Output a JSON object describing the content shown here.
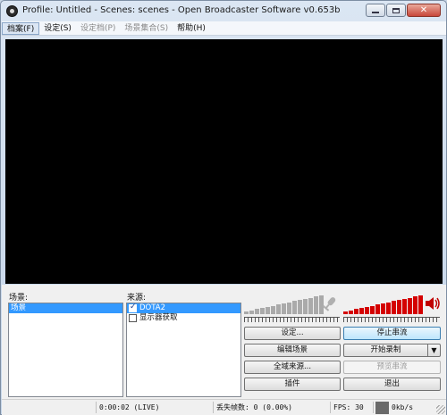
{
  "window": {
    "title": "Profile: Untitled - Scenes: scenes - Open Broadcaster Software v0.653b"
  },
  "menu": [
    {
      "label": "档案(F)",
      "state": "active"
    },
    {
      "label": "设定(S)",
      "state": "normal"
    },
    {
      "label": "设定档(P)",
      "state": "disabled"
    },
    {
      "label": "场景集合(S)",
      "state": "disabled"
    },
    {
      "label": "帮助(H)",
      "state": "normal"
    }
  ],
  "scenes": {
    "label": "场景:",
    "items": [
      {
        "label": "场景",
        "selected": true
      }
    ]
  },
  "sources": {
    "label": "来源:",
    "items": [
      {
        "label": "DOTA2",
        "checked": true,
        "selected": true
      },
      {
        "label": "显示器获取",
        "checked": false,
        "selected": false
      }
    ]
  },
  "mic_meter": {
    "level": 0,
    "color_active": "#aaaaaa"
  },
  "desktop_meter": {
    "level": 1.0,
    "color_active": "#d40000"
  },
  "buttons": {
    "settings": "设定...",
    "stop_stream": "停止串流",
    "edit_scene": "编辑场景",
    "start_record": "开始录制",
    "global_sources": "全域来源...",
    "preview_stream": "预览串流",
    "plugins": "插件",
    "exit": "退出"
  },
  "status": {
    "time": "0:00:02 (LIVE)",
    "dropped": "丢失帧数: 0 (0.00%)",
    "fps": "FPS: 30",
    "bitrate": "0kb/s",
    "bitrate_color": "#6a6a6a"
  }
}
